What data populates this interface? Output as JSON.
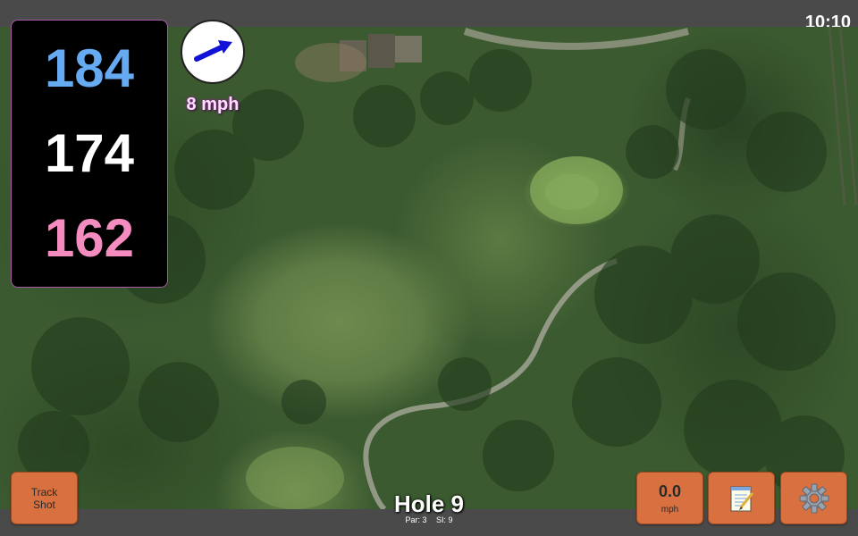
{
  "status": {
    "time": "10:10"
  },
  "distances": {
    "back": "184",
    "middle": "174",
    "front": "162"
  },
  "wind": {
    "speed_label": "8 mph",
    "icon": "wind-arrow-icon"
  },
  "track_shot": {
    "line1": "Track",
    "line2": "Shot"
  },
  "speed": {
    "value": "0.0",
    "unit": "mph"
  },
  "notes": {
    "icon": "notepad-icon"
  },
  "settings": {
    "icon": "gear-icon"
  },
  "hole": {
    "title": "Hole 9",
    "par": "Par: 3",
    "si": "SI: 9"
  },
  "colors": {
    "back_distance": "#66aaf2",
    "middle_distance": "#ffffff",
    "front_distance": "#f48cc0",
    "button": "#d8713f",
    "wind_arrow": "#1212d6"
  }
}
